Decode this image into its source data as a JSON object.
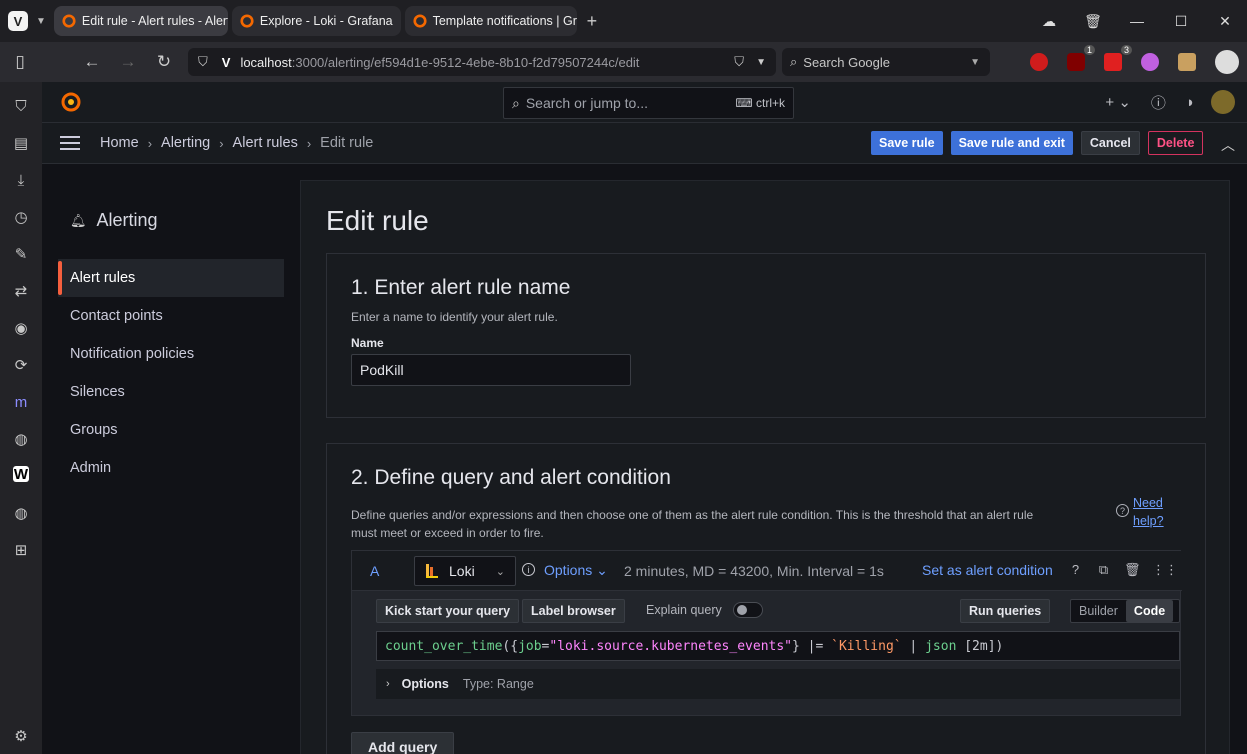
{
  "browser": {
    "tabs": [
      {
        "title": "Edit rule - Alert rules - Alert",
        "active": true
      },
      {
        "title": "Explore - Loki - Grafana",
        "active": false
      },
      {
        "title": "Template notifications | Gra",
        "active": false
      }
    ],
    "url": {
      "host": "localhost",
      "path": ":3000/alerting/ef594d1e-9512-4ebe-8b10-f2d79507244c/edit"
    },
    "search_placeholder": "Search Google",
    "extension_badges": [
      "1",
      "3"
    ]
  },
  "grafana": {
    "search_placeholder": "Search or jump to...",
    "search_shortcut": "ctrl+k",
    "breadcrumb": [
      "Home",
      "Alerting",
      "Alert rules",
      "Edit rule"
    ],
    "actions": {
      "save": "Save rule",
      "save_exit": "Save rule and exit",
      "cancel": "Cancel",
      "delete": "Delete"
    },
    "nav": {
      "title": "Alerting",
      "items": [
        "Alert rules",
        "Contact points",
        "Notification policies",
        "Silences",
        "Groups",
        "Admin"
      ],
      "active_index": 0
    },
    "page_title": "Edit rule",
    "step1": {
      "title": "1. Enter alert rule name",
      "description": "Enter a name to identify your alert rule.",
      "name_label": "Name",
      "name_value": "PodKill"
    },
    "step2": {
      "title": "2. Define query and alert condition",
      "description_line1": "Define queries and/or expressions and then choose one of them as the alert rule condition. This is the threshold that an alert rule",
      "description_line2": "must meet or exceed in order to fire.",
      "help_line1": "Need",
      "help_line2": "help?",
      "query": {
        "ref_id": "A",
        "datasource": "Loki",
        "options_link": "Options",
        "options_summary": "2 minutes, MD = 43200, Min. Interval = 1s",
        "set_condition": "Set as alert condition",
        "kick_start": "Kick start your query",
        "label_browser": "Label browser",
        "explain_query": "Explain query",
        "run_queries": "Run queries",
        "mode_builder": "Builder",
        "mode_code": "Code",
        "expr": {
          "fn": "count_over_time",
          "open": "({",
          "label": "job",
          "eq": "=",
          "value": "\"loki.source.kubernetes_events\"",
          "close": "}",
          "pipe1": " |= ",
          "match": "`Killing`",
          "pipe2": " | ",
          "parser": "json",
          "range": " [2m])"
        },
        "options_label": "Options",
        "options_type": "Type: Range"
      },
      "add_query": "Add query"
    }
  }
}
